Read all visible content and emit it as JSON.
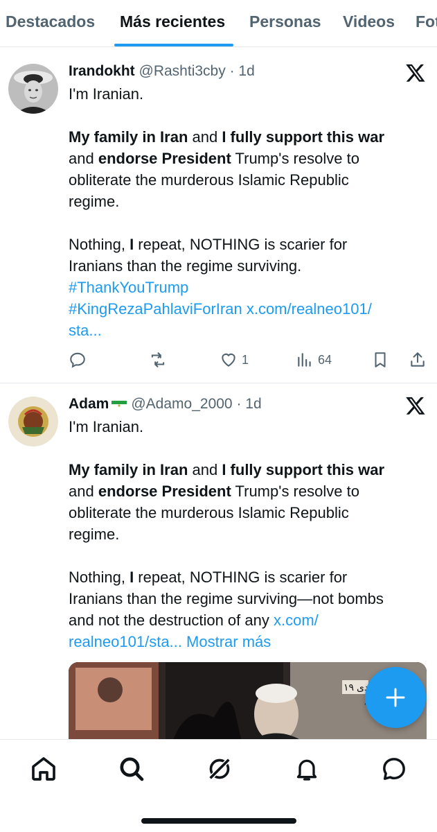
{
  "tabs": [
    {
      "label": "Destacados",
      "active": false
    },
    {
      "label": "Más recientes",
      "active": true
    },
    {
      "label": "Personas",
      "active": false
    },
    {
      "label": "Videos",
      "active": false
    },
    {
      "label": "Fot",
      "active": false
    }
  ],
  "posts": [
    {
      "name": "Irandokht",
      "handle": "@Rashti3cby",
      "time": "· 1d",
      "lines": [
        [
          {
            "t": "I'm Iranian."
          }
        ],
        [],
        [
          {
            "t": "My family in Iran",
            "b": true
          },
          {
            "t": " and "
          },
          {
            "t": "I fully support this war",
            "b": true
          }
        ],
        [
          {
            "t": "and "
          },
          {
            "t": "endorse President",
            "b": true
          },
          {
            "t": " Trump's resolve to"
          }
        ],
        [
          {
            "t": "obliterate the murderous Islamic Republic"
          }
        ],
        [
          {
            "t": "regime."
          }
        ],
        [],
        [
          {
            "t": "Nothing, "
          },
          {
            "t": "I",
            "b": true
          },
          {
            "t": " repeat, NOTHING is scarier for"
          }
        ],
        [
          {
            "t": "Iranians than the regime surviving."
          }
        ],
        [
          {
            "t": "#ThankYouTrump",
            "link": true
          }
        ],
        [
          {
            "t": "#KingRezaPahlaviForIran",
            "link": true
          },
          {
            "t": " "
          },
          {
            "t": "x.com/realneo101/",
            "link": true
          }
        ],
        [
          {
            "t": "sta...",
            "link": true
          }
        ]
      ],
      "actions": {
        "replies": "",
        "reposts": "",
        "likes": "1",
        "views": "64"
      }
    },
    {
      "name": "Adam",
      "flag": "iran-lion-sun-flag",
      "handle": "@Adamo_2000",
      "time": "· 1d",
      "lines": [
        [
          {
            "t": "I'm Iranian."
          }
        ],
        [],
        [
          {
            "t": "My family in Iran",
            "b": true
          },
          {
            "t": " and "
          },
          {
            "t": "I fully support this war",
            "b": true
          }
        ],
        [
          {
            "t": "and "
          },
          {
            "t": "endorse President",
            "b": true
          },
          {
            "t": " Trump's resolve to"
          }
        ],
        [
          {
            "t": "obliterate the murderous Islamic Republic"
          }
        ],
        [
          {
            "t": "regime."
          }
        ],
        [],
        [
          {
            "t": "Nothing, "
          },
          {
            "t": "I",
            "b": true
          },
          {
            "t": " repeat, NOTHING is scarier for"
          }
        ],
        [
          {
            "t": "Iranians than the regime surviving—not bombs"
          }
        ],
        [
          {
            "t": "and not the destruction of any "
          },
          {
            "t": "x.com/",
            "link": true
          }
        ],
        [
          {
            "t": "realneo101/sta...",
            "link": true
          },
          {
            "t": " Mostrar más",
            "link": true
          }
        ]
      ],
      "media_caption": "۱۹ دی"
    }
  ],
  "fab": {
    "icon": "compose-plus-icon"
  },
  "nav": [
    "home-icon",
    "search-icon",
    "grok-icon",
    "notifications-bell-icon",
    "messages-icon"
  ],
  "colors": {
    "accent": "#1d9bf0",
    "text": "#0f1419",
    "muted": "#536471"
  }
}
